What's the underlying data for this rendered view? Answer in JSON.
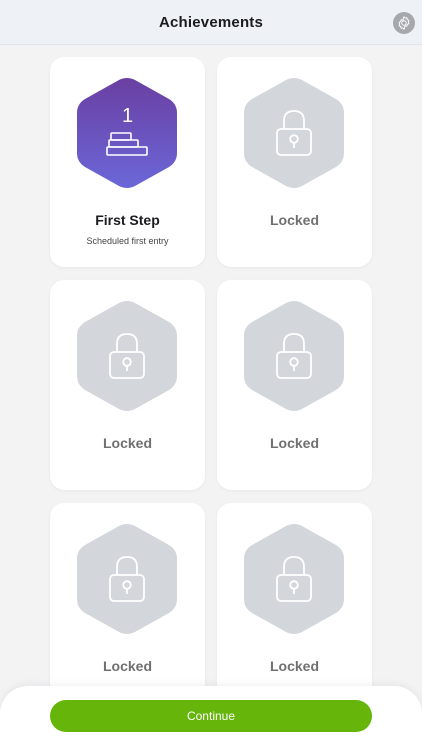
{
  "header": {
    "title": "Achievements",
    "settings_icon": "gear-icon"
  },
  "achievements": [
    {
      "title": "First Step",
      "subtitle": "Scheduled first entry",
      "level": "1",
      "unlocked": true,
      "icon": "stairs-icon"
    },
    {
      "title": "Locked",
      "unlocked": false,
      "icon": "lock-icon"
    },
    {
      "title": "Locked",
      "unlocked": false,
      "icon": "lock-icon"
    },
    {
      "title": "Locked",
      "unlocked": false,
      "icon": "lock-icon"
    },
    {
      "title": "Locked",
      "unlocked": false,
      "icon": "lock-icon"
    },
    {
      "title": "Locked",
      "unlocked": false,
      "icon": "lock-icon"
    }
  ],
  "footer": {
    "continue_label": "Continue"
  },
  "colors": {
    "accent_green": "#66b50b",
    "badge_purple_top": "#6a3fa2",
    "badge_purple_bottom": "#6b67d8",
    "locked_hex": "#d3d6db"
  }
}
